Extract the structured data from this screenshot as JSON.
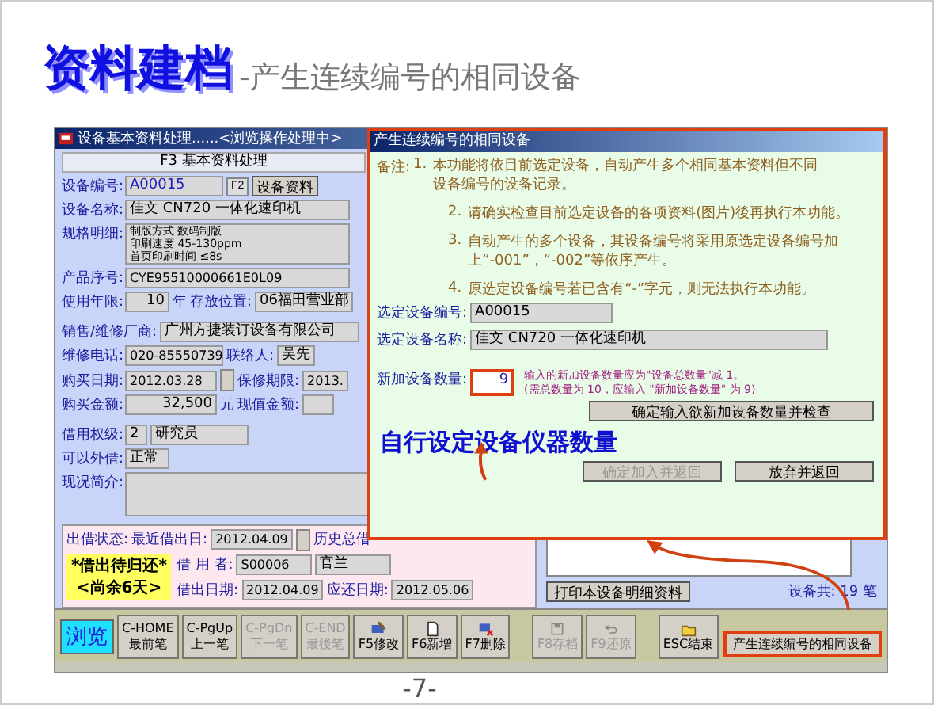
{
  "slide": {
    "title": "资料建档",
    "subtitle": "-产生连续编号的相同设备",
    "page_number": "-7-"
  },
  "main_window": {
    "title": "设备基本资料处理......<浏览操作处理中>",
    "header": "F3 基本资料处理",
    "device_no": {
      "label": "设备编号:",
      "value": "A00015",
      "key": "F2",
      "detail_button": "设备资料"
    },
    "device_name": {
      "label": "设备名称:",
      "value": "佳文 CN720 一体化速印机"
    },
    "spec": {
      "label": "规格明细:",
      "lines": [
        "制版方式 数码制版",
        "印刷速度 45-130ppm",
        "首页印刷时间 ≤8s"
      ]
    },
    "serial": {
      "label": "产品序号:",
      "value": "CYE95510000661E0L09"
    },
    "life": {
      "label": "使用年限:",
      "value": "10",
      "unit": "年",
      "location_label": "存放位置:",
      "location": "06福田营业部"
    },
    "vendor": {
      "label": "销售/维修厂商:",
      "value": "广州方捷装订设备有限公司"
    },
    "phone": {
      "label": "维修电话:",
      "value": "020-85550739",
      "contact_label": "联络人:",
      "contact": "吴先"
    },
    "purchase_date": {
      "label": "购买日期:",
      "value": "2012.03.28",
      "warranty_label": "保修期限:",
      "warranty": "2013."
    },
    "amount": {
      "label": "购买金额:",
      "value": "32,500",
      "unit": "元",
      "current_label": "现值金额:"
    },
    "level": {
      "label": "借用权级:",
      "code": "2",
      "name": "研究员"
    },
    "lendable": {
      "label": "可以外借:",
      "value": "正常"
    },
    "status_note": {
      "label": "现况简介:"
    },
    "loan": {
      "label": "出借状态:",
      "last_label": "最近借出日:",
      "last": "2012.04.09",
      "history_label": "历史总借",
      "badge": "*借出待归还*",
      "remaining": "<尚余6天>",
      "borrower_label": "借 用 者:",
      "borrower_id": "S00006",
      "borrower_name": "官兰",
      "date_label": "借出日期:",
      "date": "2012.04.09",
      "due_label": "应还日期:",
      "due": "2012.05.06"
    },
    "print_button": "打印本设备明细资料",
    "count": "设备共: 19 笔",
    "sequence_button": "产生连续编号的相同设备",
    "toolbar": [
      {
        "kind": "mode",
        "label": "浏览",
        "disabled": false
      },
      {
        "kind": "nav",
        "key": "C-HOME",
        "label": "最前笔",
        "disabled": false
      },
      {
        "kind": "nav",
        "key": "C-PgUp",
        "label": "上一笔",
        "disabled": false
      },
      {
        "kind": "nav",
        "key": "C-PgDn",
        "label": "下一笔",
        "disabled": true
      },
      {
        "kind": "nav",
        "key": "C-END",
        "label": "最後笔",
        "disabled": true
      },
      {
        "kind": "action",
        "label": "F5修改",
        "disabled": false
      },
      {
        "kind": "action",
        "label": "F6新增",
        "disabled": false
      },
      {
        "kind": "action",
        "label": "F7删除",
        "disabled": false
      },
      {
        "kind": "action",
        "label": "F8存档",
        "disabled": true
      },
      {
        "kind": "action",
        "label": "F9还原",
        "disabled": true
      },
      {
        "kind": "action",
        "label": "ESC结束",
        "disabled": false
      }
    ]
  },
  "dialog": {
    "title": "产生连续编号的相同设备",
    "notes_label": "备注:",
    "notes": [
      {
        "num": "1.",
        "text": "本功能将依目前选定设备，自动产生多个相同基本资料但不同设备编号的设备记录。"
      },
      {
        "num": "2.",
        "text": "请确实检查目前选定设备的各项资料(图片)後再执行本功能。"
      },
      {
        "num": "3.",
        "text": "自动产生的多个设备，其设备编号将采用原选定设备编号加上“-001”，“-002”等依序产生。"
      },
      {
        "num": "4.",
        "text": "原选定设备编号若已含有“-”字元，则无法执行本功能。"
      }
    ],
    "selected_no": {
      "label": "选定设备编号:",
      "value": "A00015"
    },
    "selected_name": {
      "label": "选定设备名称:",
      "value": "佳文 CN720 一体化速印机"
    },
    "quantity": {
      "label": "新加设备数量:",
      "value": "9",
      "hint": [
        "输入的新加设备数量应为\"设备总数量\"减 1。",
        "(需总数量为 10，应输入 \"新加设备数量\" 为 9)"
      ]
    },
    "check_button": "确定输入欲新加设备数量并检查",
    "annotation": "自行设定设备仪器数量",
    "buttons": [
      {
        "label": "确定加入并返回",
        "disabled": true
      },
      {
        "label": "放弃并返回",
        "disabled": false
      }
    ]
  }
}
